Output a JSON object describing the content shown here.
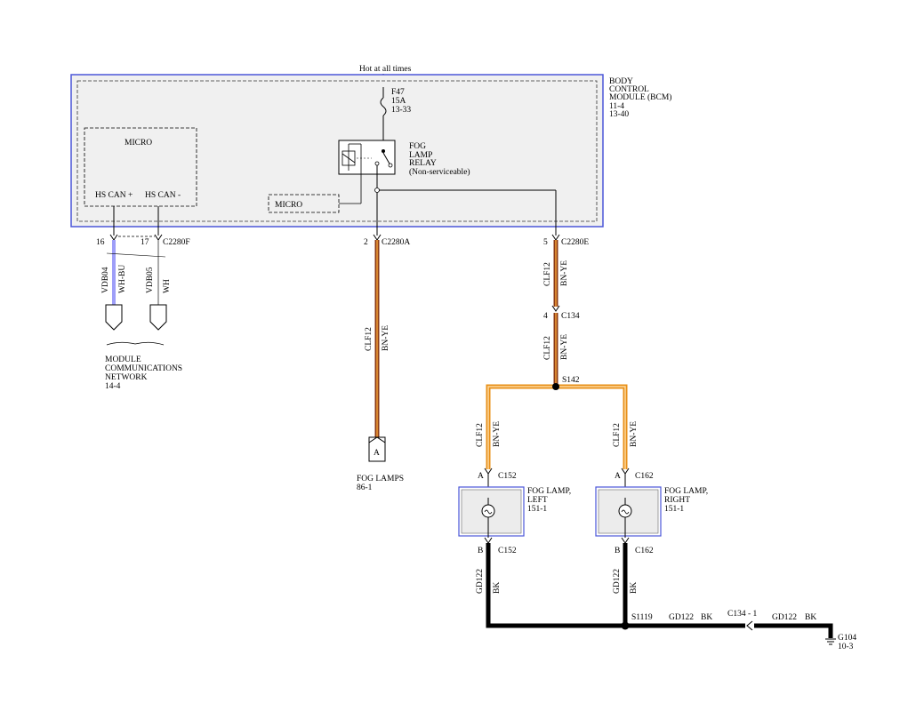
{
  "power": {
    "label": "Hot at all times"
  },
  "bcm": {
    "lines": [
      "BODY",
      "CONTROL",
      "MODULE (BCM)",
      "11-4",
      "13-40"
    ]
  },
  "fuse": {
    "lines": [
      "F47",
      "15A",
      "13-33"
    ]
  },
  "relay": {
    "lines": [
      "FOG",
      "LAMP",
      "RELAY",
      "(Non-serviceable)"
    ]
  },
  "micro_top": {
    "label": "MICRO",
    "can_plus": "HS CAN +",
    "can_minus": "HS CAN -"
  },
  "micro_small": {
    "label": "MICRO"
  },
  "left_connector": {
    "pin_a": "16",
    "pin_b": "17",
    "name": "C2280F"
  },
  "left_wires": {
    "w1_circuit": "VDB04",
    "w1_color": "WH-BU",
    "w2_circuit": "VDB05",
    "w2_color": "WH"
  },
  "network": {
    "lines": [
      "MODULE",
      "COMMUNICATIONS",
      "NETWORK",
      "14-4"
    ]
  },
  "mid_connector": {
    "pin": "2",
    "name": "C2280A"
  },
  "mid_wire": {
    "circuit": "CLF12",
    "color": "BN-YE"
  },
  "fog_lamps_ref": {
    "letter": "A",
    "lines": [
      "FOG LAMPS",
      "86-1"
    ]
  },
  "right_connector": {
    "pin": "5",
    "name": "C2280E"
  },
  "right_wire1": {
    "circuit": "CLF12",
    "color": "BN-YE"
  },
  "c134": {
    "pin": "4",
    "name": "C134"
  },
  "right_wire2": {
    "circuit": "CLF12",
    "color": "BN-YE"
  },
  "splice": {
    "name": "S142"
  },
  "left_lamp": {
    "wire_circuit": "CLF12",
    "wire_color": "BN-YE",
    "pin_a": "A",
    "conn_a": "C152",
    "lines": [
      "FOG LAMP,",
      "LEFT",
      "151-1"
    ],
    "pin_b": "B",
    "conn_b": "C152",
    "gnd_circuit": "GD122",
    "gnd_color": "BK"
  },
  "right_lamp": {
    "wire_circuit": "CLF12",
    "wire_color": "BN-YE",
    "pin_a": "A",
    "conn_a": "C162",
    "lines": [
      "FOG LAMP,",
      "RIGHT",
      "151-1"
    ],
    "pin_b": "B",
    "conn_b": "C162",
    "gnd_circuit": "GD122",
    "gnd_color": "BK"
  },
  "ground_splice": {
    "name": "S1119",
    "circuit1": "GD122",
    "color1": "BK",
    "connector": "C134 - 1",
    "circuit2": "GD122",
    "color2": "BK"
  },
  "ground": {
    "lines": [
      "G104",
      "10-3"
    ]
  },
  "colors": {
    "bcm_border": "#4b56d8",
    "bcm_fill": "#f0f0f0",
    "wire_brown": "#8b3a14",
    "wire_yellow": "#f2a03a",
    "wire_orange": "#e8901a",
    "can_blue": "#3c3cf0"
  }
}
